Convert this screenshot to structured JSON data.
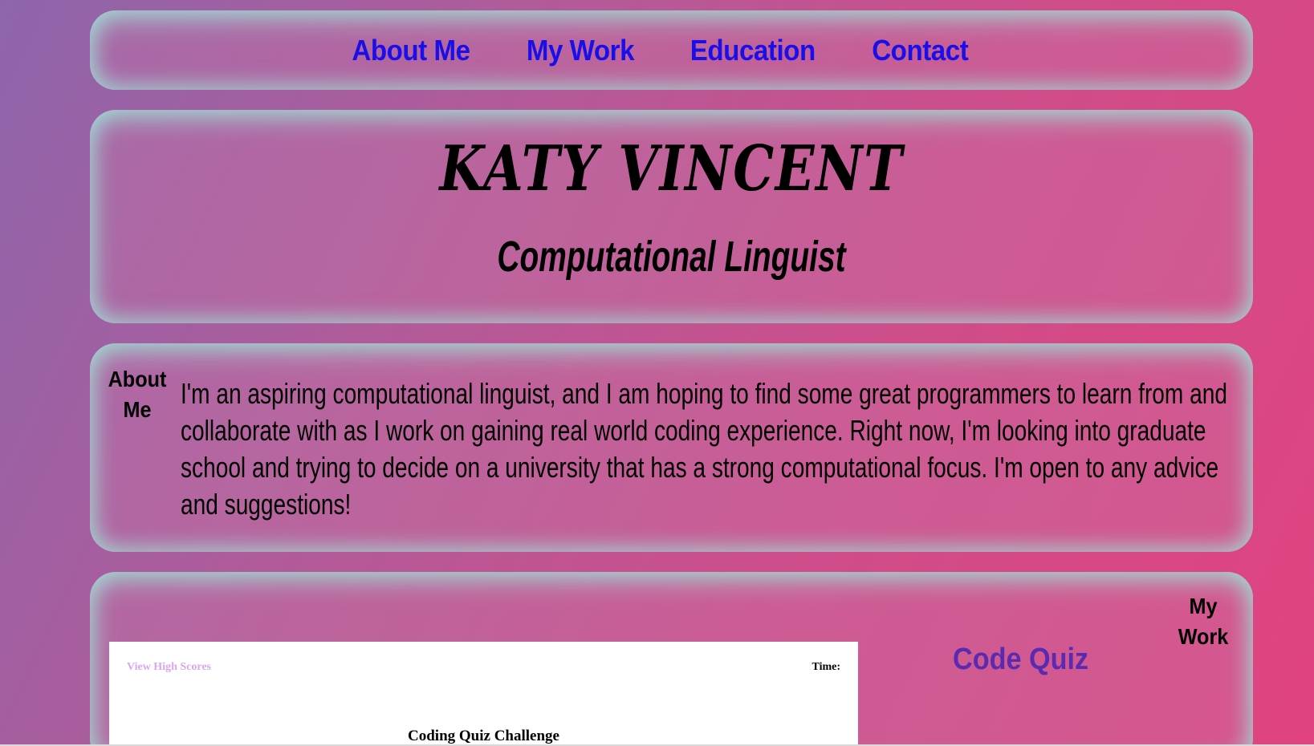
{
  "nav": {
    "items": [
      "About Me",
      "My Work",
      "Education",
      "Contact"
    ]
  },
  "hero": {
    "name": "KATY VINCENT",
    "subtitle": "Computational Linguist"
  },
  "about": {
    "label": "About Me",
    "bio": "I'm an aspiring computational linguist, and I am hoping to find some great programmers to learn from and collaborate with as I work on gaining real world coding experience. Right now, I'm looking into graduate school and trying to decide on a university that has a strong computational focus. I'm open to any advice and suggestions!"
  },
  "work": {
    "label": "My Work",
    "project_title": "Code Quiz",
    "screenshot": {
      "high_scores": "View High Scores",
      "time_label": "Time:",
      "quiz_title": "Coding Quiz Challenge"
    }
  },
  "colors": {
    "nav_link": "#1a0fe6",
    "project_title": "#5a2bb0",
    "card_glow": "#a0e1d7"
  }
}
